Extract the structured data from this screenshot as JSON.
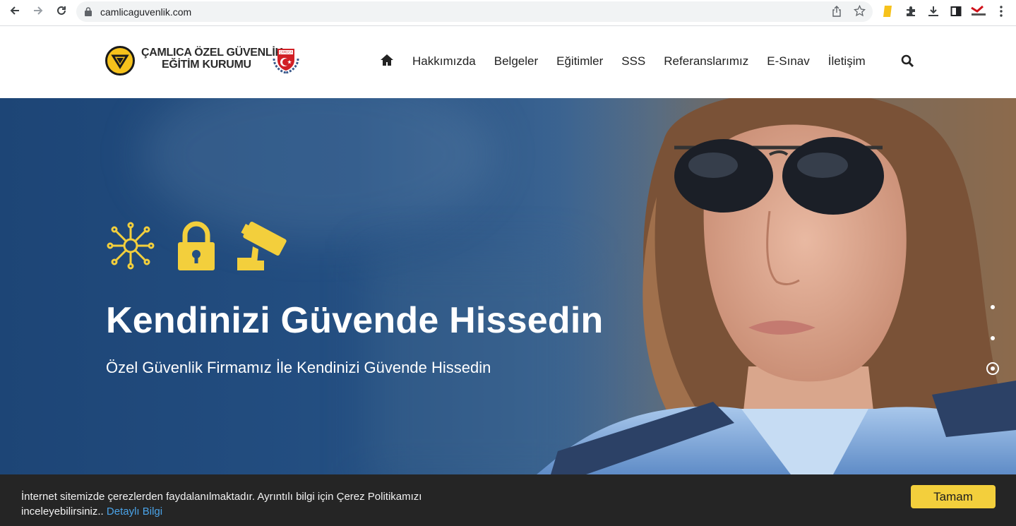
{
  "browser": {
    "url": "camlicaguvenlik.com",
    "back_icon": "arrow-left-icon",
    "forward_icon": "arrow-right-icon",
    "reload_icon": "reload-icon"
  },
  "site": {
    "logo_line1": "ÇAMLICA ÖZEL GÜVENLİK",
    "logo_line2": "EĞİTİM KURUMU",
    "emblem_text": "ÇAMLICA GÜVENLİK",
    "nav": [
      {
        "label": "Hakkımızda"
      },
      {
        "label": "Belgeler"
      },
      {
        "label": "Eğitimler"
      },
      {
        "label": "SSS"
      },
      {
        "label": "Referanslarımız"
      },
      {
        "label": "E-Sınav"
      },
      {
        "label": "İletişim"
      }
    ]
  },
  "hero": {
    "title": "Kendinizi Güvende Hissedin",
    "subtitle": "Özel Güvenlik Firmamız İle Kendinizi Güvende Hissedin",
    "icons": [
      "network-icon",
      "padlock-icon",
      "security-camera-icon"
    ],
    "slides": 3,
    "active_slide": 3,
    "accent": "#f3cf3c"
  },
  "cookie": {
    "message": "İnternet sitemizde çerezlerden faydalanılmaktadır. Ayrıntılı bilgi için Çerez Politikamızı inceleyebilirsiniz..",
    "link": "Detaylı Bilgi",
    "button": "Tamam"
  }
}
